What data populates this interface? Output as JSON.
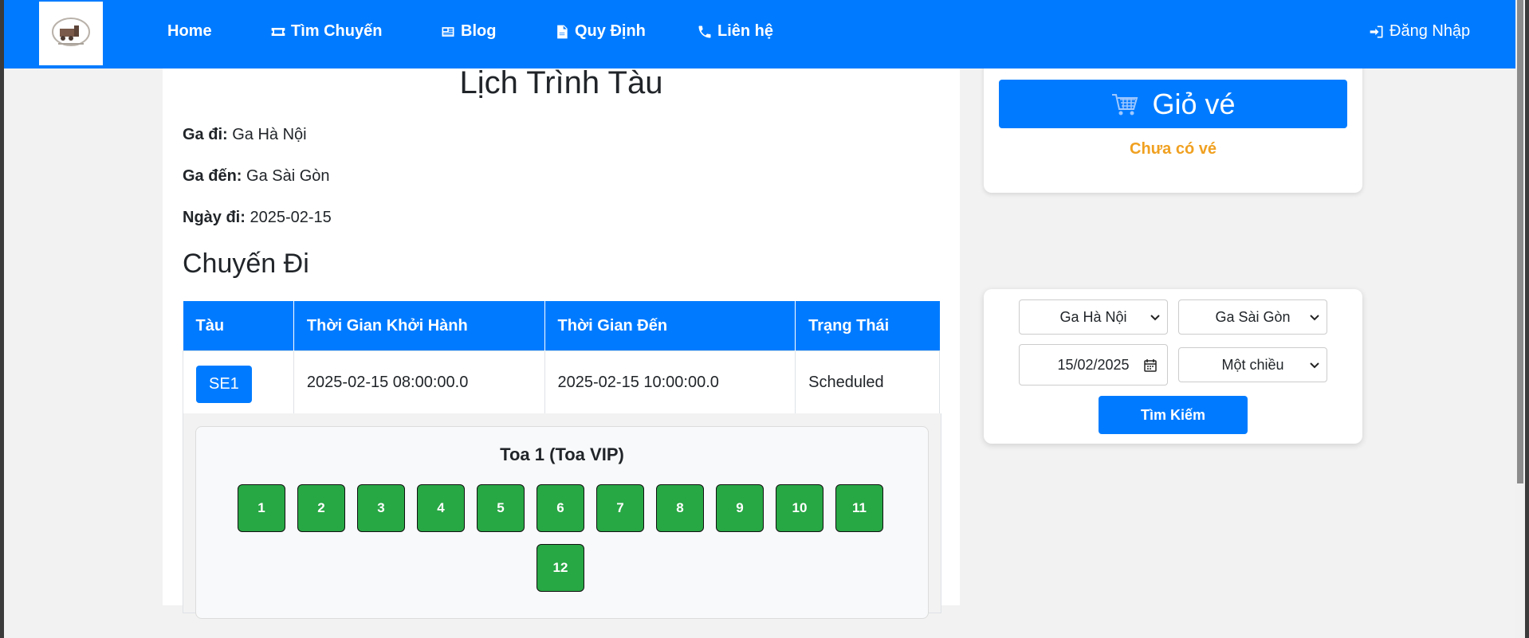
{
  "nav": {
    "home": "Home",
    "find_trip": "Tìm Chuyến",
    "blog": "Blog",
    "rules": "Quy Định",
    "contact": "Liên hệ",
    "login": "Đăng Nhập"
  },
  "schedule": {
    "title": "Lịch Trình Tàu",
    "from_label": "Ga đi:",
    "from_value": "Ga Hà Nội",
    "to_label": "Ga đến:",
    "to_value": "Ga Sài Gòn",
    "date_label": "Ngày đi:",
    "date_value": "2025-02-15",
    "outbound_title": "Chuyến Đi"
  },
  "table": {
    "headers": [
      "Tàu",
      "Thời Gian Khởi Hành",
      "Thời Gian Đến",
      "Trạng Thái"
    ],
    "rows": [
      {
        "train": "SE1",
        "depart": "2025-02-15 08:00:00.0",
        "arrive": "2025-02-15 10:00:00.0",
        "status": "Scheduled"
      }
    ]
  },
  "coach": {
    "title": "Toa 1 (Toa VIP)",
    "seats": [
      "1",
      "2",
      "3",
      "4",
      "5",
      "6",
      "7",
      "8",
      "9",
      "10",
      "11",
      "12"
    ],
    "seat_color": "#28a745"
  },
  "cart": {
    "button_label": "Giỏ vé",
    "empty_text": "Chưa có vé"
  },
  "search": {
    "from_selected": "Ga Hà Nội",
    "to_selected": "Ga Sài Gòn",
    "date_value": "15/02/2025",
    "trip_type": "Một chiều",
    "button_label": "Tìm Kiếm"
  },
  "colors": {
    "primary": "#007bff",
    "warning_text": "#f0a020",
    "seat_available": "#28a745"
  }
}
